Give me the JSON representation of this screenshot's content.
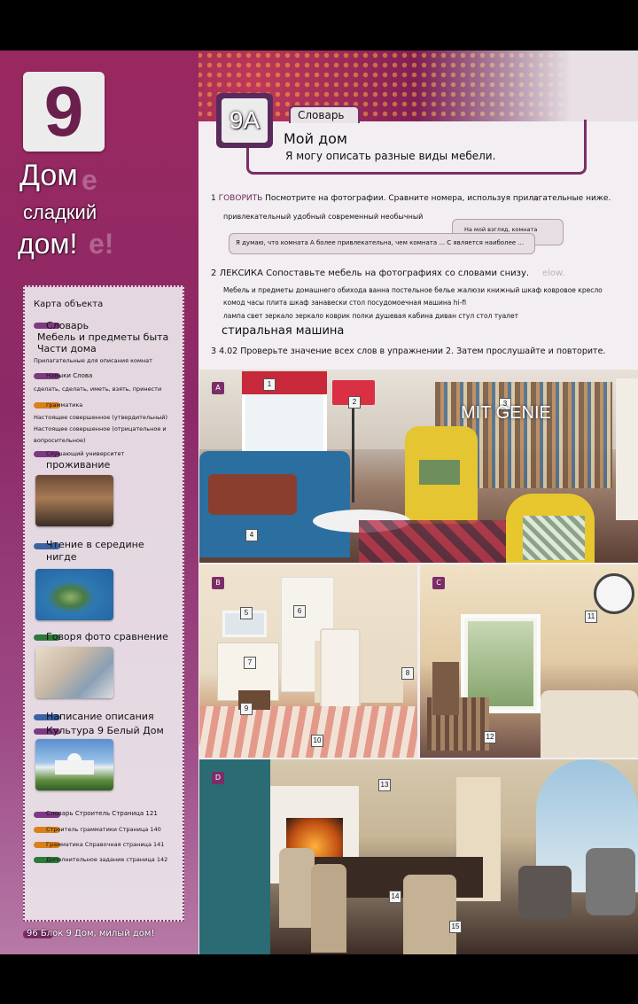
{
  "unit": {
    "number": "9",
    "title_line1": "Дом",
    "title_line2": "сладкий",
    "title_line3": "дом!"
  },
  "contents": {
    "title": "Карта объекта",
    "items": [
      "Словарь",
      "Мебель и предметы быта",
      "Части дома",
      "Прилагательные для описания комнат",
      "Навыки Слова",
      "сделать, сделать, иметь, взять, принести",
      "грамматика",
      "Настоящее совершенное (утвердительный)",
      "Настоящее совершенное (отрицательное и",
      "вопросительное)",
      "Слушающий университет",
      "проживание",
      "Чтение в середине",
      "нигде",
      "Говоря фото сравнение",
      "Написание описания",
      "Культура 9 Белый Дом",
      "Словарь Строитель Страница 121",
      "Строитель грамматики Страница 140",
      "Грамматика Справочная страница 141",
      "Дополнительное задание страница 142"
    ]
  },
  "footer": {
    "text": "96 Блок 9 Дом, милый дом!"
  },
  "lesson": {
    "code": "9A",
    "section": "Словарь",
    "title": "Мой дом",
    "goal": "Я могу описать разные виды мебели."
  },
  "exercise1": {
    "number": "1",
    "tag": "ГОВОРИТЬ",
    "instruction": "Посмотрите на фотографии. Сравните номера, используя прилагательные ниже.",
    "adjectives": "привлекательный удобный современный необычный",
    "speech_opinion": "На мой взгляд, комната",
    "speech_compare": "Я думаю, что комната А более привлекательна, чем комната ... С является наиболее ..."
  },
  "exercise2": {
    "number": "2",
    "tag": "ЛЕКСИКА",
    "instruction": "Сопоставьте мебель на фотографиях со словами снизу.",
    "line1": "Мебель и предметы домашнего обихода ванна постельное белье жалюзи книжный шкаф ковровое кресло",
    "line2": "комод часы плита шкаф занавески стол посудомоечная машина hi-fi",
    "line3": "лампа свет зеркало зеркало коврик полки душевая кабина диван стул стол туалет",
    "line4": "стиральная машина"
  },
  "exercise3": {
    "number": "3",
    "audio": "4.02",
    "instruction": "Проверьте значение всех слов в упражнении 2. Затем прослушайте и повторите."
  },
  "photos": {
    "a": {
      "letter": "A",
      "numbers": [
        "1",
        "2",
        "3",
        "4"
      ]
    },
    "b": {
      "letter": "B",
      "numbers": [
        "5",
        "6",
        "7",
        "8",
        "9",
        "10"
      ]
    },
    "c": {
      "letter": "C",
      "numbers": [
        "11",
        "12"
      ]
    },
    "d": {
      "letter": "D",
      "numbers": [
        "13",
        "14",
        "15"
      ]
    }
  },
  "watermark": "MIT GENIE"
}
